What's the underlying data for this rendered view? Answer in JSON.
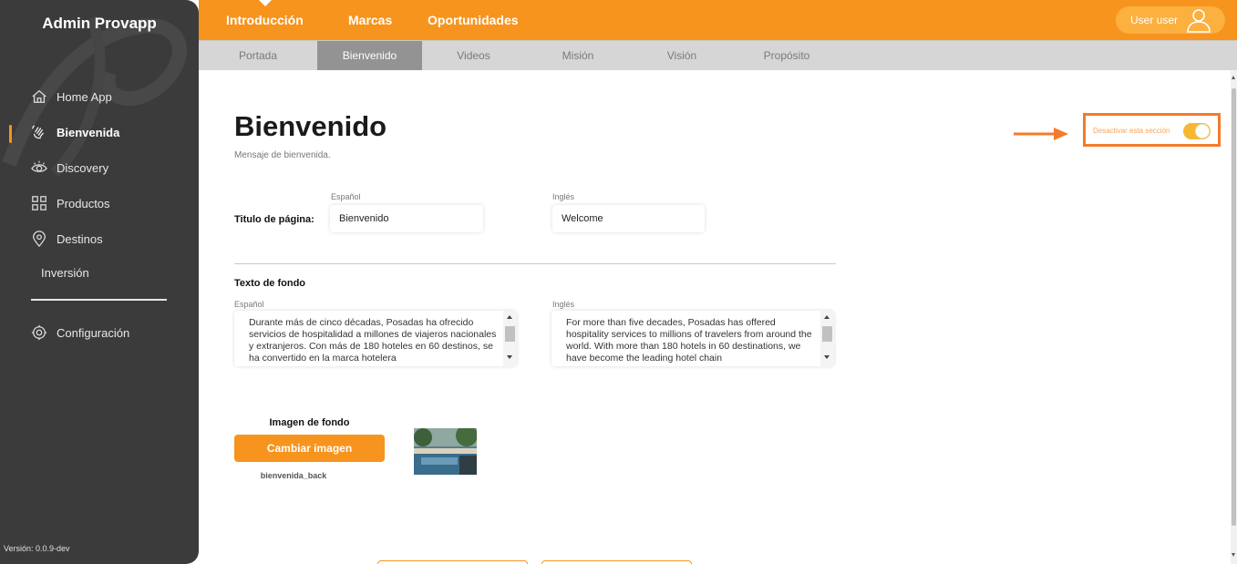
{
  "sidebar": {
    "brand": "Admin Provapp",
    "items": [
      {
        "label": "Home App",
        "icon": "home-icon"
      },
      {
        "label": "Bienvenida",
        "icon": "wave-hand-icon",
        "active": true
      },
      {
        "label": "Discovery",
        "icon": "eye-icon"
      },
      {
        "label": "Productos",
        "icon": "grid-icon"
      },
      {
        "label": "Destinos",
        "icon": "location-pin-icon"
      },
      {
        "label": "Inversión",
        "icon": ""
      }
    ],
    "config_label": "Configuración",
    "version": "Versión: 0.0.9-dev"
  },
  "topbar": {
    "tabs": [
      "Introducción",
      "Marcas",
      "Oportunidades"
    ],
    "active_tab": "Introducción",
    "user_label": "User user"
  },
  "subtabs": {
    "items": [
      "Portada",
      "Bienvenido",
      "Videos",
      "Misión",
      "Visión",
      "Propósito"
    ],
    "active": "Bienvenido"
  },
  "page": {
    "title": "Bienvenido",
    "subtitle": "Mensaje de bienvenida.",
    "toggle_label": "Desactivar esta sección",
    "toggle_on": true
  },
  "form": {
    "titulo_label": "Titulo de página:",
    "spanish_label": "Español",
    "english_label": "Inglés",
    "titulo_es": "Bienvenido",
    "titulo_en": "Welcome",
    "texto_label": "Texto de fondo",
    "texto_es": "Durante más de cinco décadas, Posadas ha ofrecido servicios de hospitalidad a millones de viajeros nacionales y extranjeros. Con más de 180 hoteles en 60 destinos, se ha convertido en la marca hotelera",
    "texto_en": "For more than five decades, Posadas has offered hospitality services to millions of travelers from around the world. With more than 180 hotels in 60 destinations, we have become the leading hotel chain",
    "imagen_label": "Imagen de fondo",
    "change_button": "Cambiar imagen",
    "file_name": "bienvenida_back"
  },
  "colors": {
    "accent": "#f7941d",
    "sidebar_bg": "#3b3b3b",
    "highlight_box": "#f47b2a"
  }
}
